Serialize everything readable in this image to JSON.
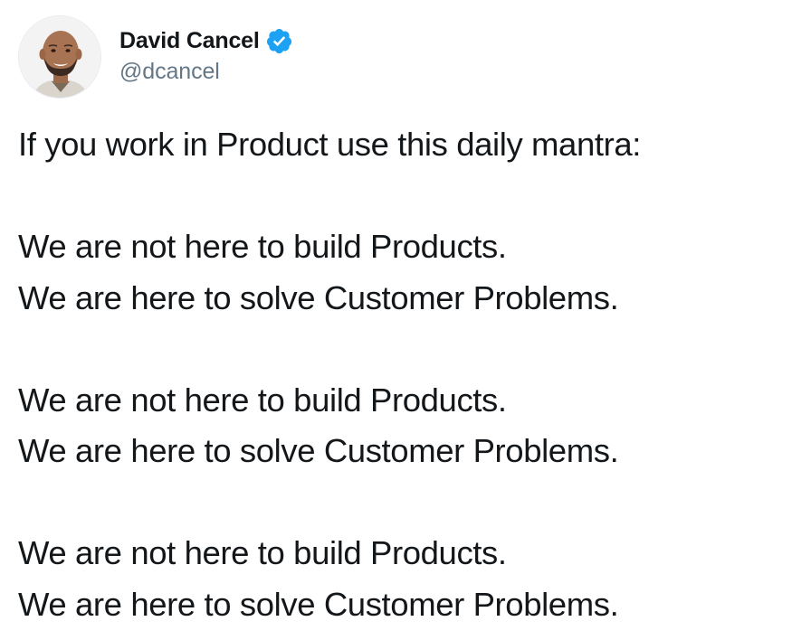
{
  "tweet": {
    "author": {
      "display_name": "David Cancel",
      "handle": "@dcancel",
      "verified": true,
      "avatar": "profile-photo"
    },
    "text_lines": [
      "If you work in Product use this daily mantra:",
      "We are not here to build Products.",
      "We are here to solve Customer Problems.",
      "We are not here to build Products.",
      "We are here to solve Customer Problems.",
      "We are not here to build Products.",
      "We are here to solve Customer Problems."
    ]
  },
  "colors": {
    "text": "#14171a",
    "secondary_text": "#657786",
    "verified_blue": "#1da1f2",
    "background": "#ffffff"
  }
}
